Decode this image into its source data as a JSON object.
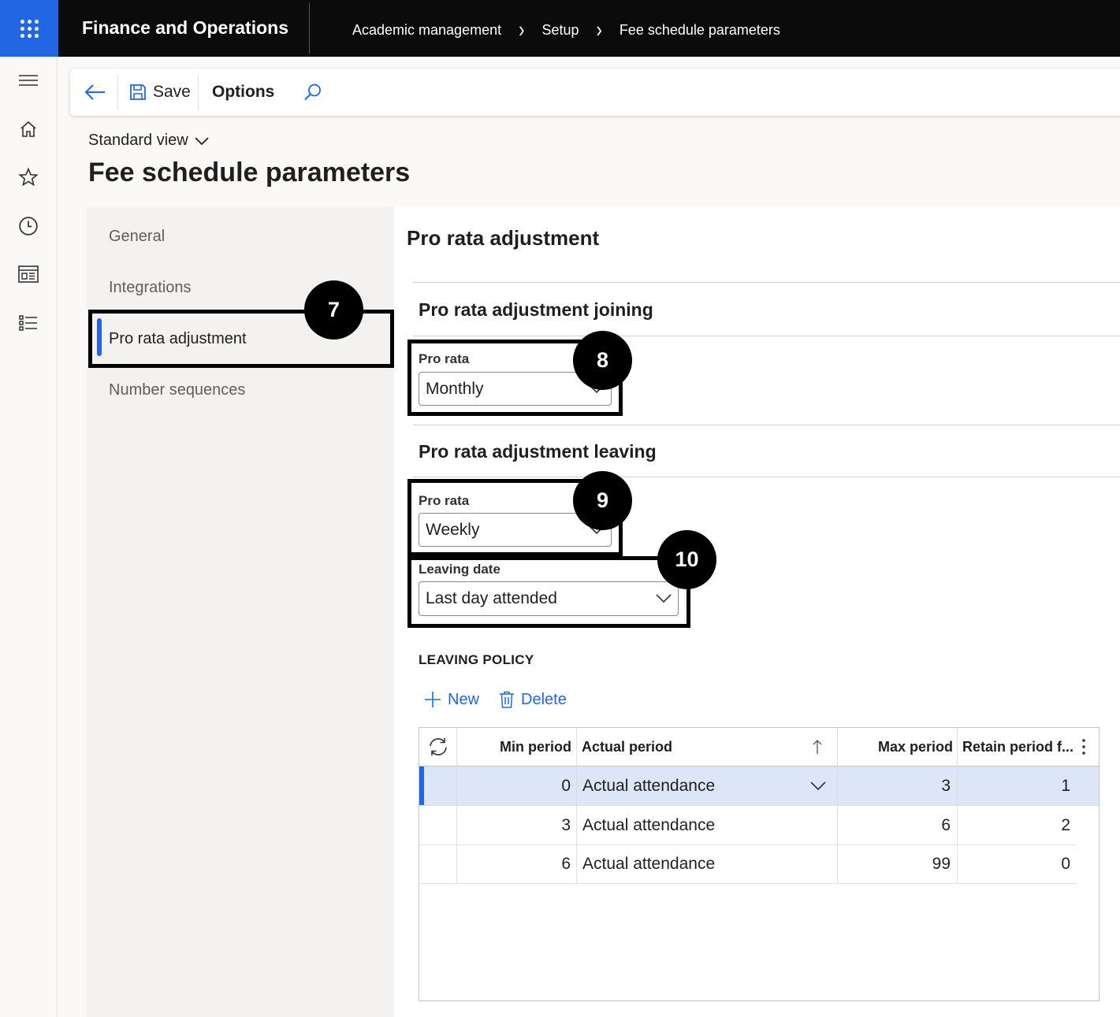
{
  "topbar": {
    "app_title": "Finance and Operations",
    "breadcrumbs": [
      "Academic management",
      "Setup",
      "Fee schedule parameters"
    ]
  },
  "leftrail": {
    "icons": [
      "hamburger-icon",
      "home-icon",
      "star-icon",
      "clock-icon",
      "workspace-icon",
      "list-icon"
    ]
  },
  "actionbar": {
    "save_label": "Save",
    "options_label": "Options"
  },
  "page": {
    "view_label": "Standard view",
    "title": "Fee schedule parameters"
  },
  "nav": {
    "items": [
      {
        "label": "General"
      },
      {
        "label": "Integrations"
      },
      {
        "label": "Pro rata adjustment"
      },
      {
        "label": "Number sequences"
      }
    ]
  },
  "content": {
    "section_title": "Pro rata adjustment",
    "joining": {
      "title": "Pro rata adjustment joining",
      "pro_rata_label": "Pro rata",
      "pro_rata_value": "Monthly"
    },
    "leaving": {
      "title": "Pro rata adjustment leaving",
      "pro_rata_label": "Pro rata",
      "pro_rata_value": "Weekly",
      "leaving_date_label": "Leaving date",
      "leaving_date_value": "Last day attended"
    },
    "policy": {
      "heading": "LEAVING POLICY",
      "new_label": "New",
      "delete_label": "Delete",
      "columns": {
        "min_period": "Min period",
        "actual_period": "Actual period",
        "max_period": "Max period",
        "retain_period": "Retain period f..."
      },
      "rows": [
        {
          "min": "0",
          "actual": "Actual attendance",
          "max": "3",
          "retain": "1"
        },
        {
          "min": "3",
          "actual": "Actual attendance",
          "max": "6",
          "retain": "2"
        },
        {
          "min": "6",
          "actual": "Actual attendance",
          "max": "99",
          "retain": "0"
        }
      ]
    }
  },
  "callouts": [
    "7",
    "8",
    "9",
    "10"
  ],
  "colors": {
    "accent": "#2266e3",
    "topbar": "#0b0b0b",
    "selected_row": "#dce6f8"
  }
}
